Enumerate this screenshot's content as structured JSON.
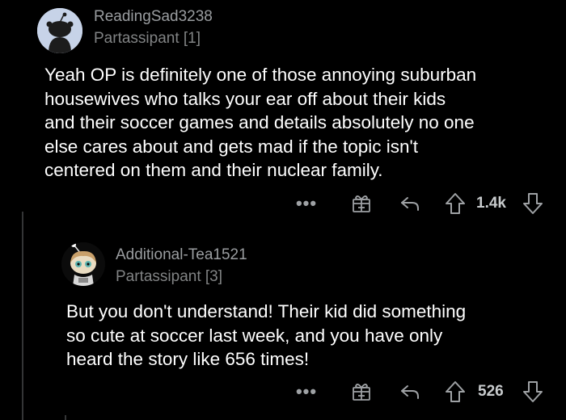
{
  "comments": [
    {
      "username": "ReadingSad3238",
      "flair": "Partassipant [1]",
      "body_lines": [
        "Yeah OP is definitely one of those annoying suburban",
        "housewives who talks your ear off about their kids",
        "and their soccer games and details absolutely no one",
        "else cares about and gets mad if the topic isn't",
        "centered on them and their nuclear family."
      ],
      "score": "1.4k",
      "more_label": "•••",
      "icons": {
        "avatar": "snoo-avatar-icon",
        "award": "award-gift-icon",
        "reply": "reply-arrow-icon",
        "upvote": "upvote-arrow-icon",
        "downvote": "downvote-arrow-icon"
      }
    },
    {
      "username": "Additional-Tea1521",
      "flair": "Partassipant [3]",
      "body_lines": [
        "But you don't understand! Their kid did something",
        "so cute at soccer last week, and you have only",
        "heard the story like 656 times!"
      ],
      "score": "526",
      "more_label": "•••",
      "icons": {
        "avatar": "custom-avatar-icon",
        "award": "award-gift-icon",
        "reply": "reply-arrow-icon",
        "upvote": "upvote-arrow-icon",
        "downvote": "downvote-arrow-icon"
      }
    }
  ],
  "colors": {
    "background": "#000000",
    "body_text": "#ffffff",
    "meta_text": "#9a9da0",
    "thread_line": "#343536"
  }
}
